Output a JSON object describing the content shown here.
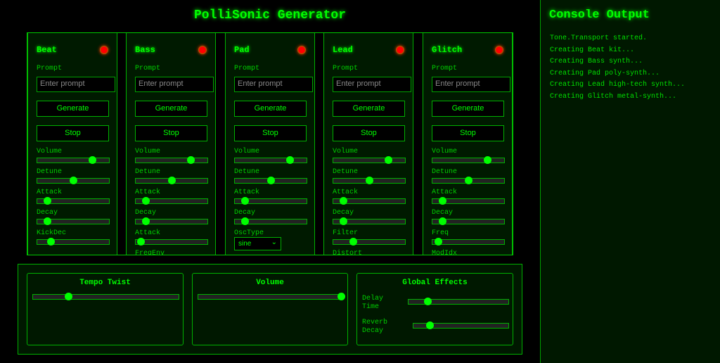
{
  "title": "PolliSonic Generator",
  "colors": {
    "accent": "#00ff00",
    "background": "#000000",
    "panel": "#001a00",
    "led": "#ff0000"
  },
  "channels": [
    {
      "name": "Beat",
      "prompt_label": "Prompt",
      "placeholder": "Enter prompt",
      "generate": "Generate",
      "stop": "Stop",
      "sliders": [
        {
          "label": "Volume",
          "value": 0.76
        },
        {
          "label": "Detune",
          "value": 0.5
        },
        {
          "label": "Attack",
          "value": 0.14
        },
        {
          "label": "Decay",
          "value": 0.14
        },
        {
          "label": "KickDec",
          "value": 0.19
        }
      ]
    },
    {
      "name": "Bass",
      "prompt_label": "Prompt",
      "placeholder": "Enter prompt",
      "generate": "Generate",
      "stop": "Stop",
      "sliders": [
        {
          "label": "Volume",
          "value": 0.76
        },
        {
          "label": "Detune",
          "value": 0.5
        },
        {
          "label": "Attack",
          "value": 0.14
        },
        {
          "label": "Decay",
          "value": 0.14
        },
        {
          "label": "Attack",
          "value": 0.07
        }
      ],
      "extra_label": "FreqEnv"
    },
    {
      "name": "Pad",
      "prompt_label": "Prompt",
      "placeholder": "Enter prompt",
      "generate": "Generate",
      "stop": "Stop",
      "sliders": [
        {
          "label": "Volume",
          "value": 0.76
        },
        {
          "label": "Detune",
          "value": 0.5
        },
        {
          "label": "Attack",
          "value": 0.14
        },
        {
          "label": "Decay",
          "value": 0.14
        }
      ],
      "select_label": "OscType",
      "select_value": "sine"
    },
    {
      "name": "Lead",
      "prompt_label": "Prompt",
      "placeholder": "Enter prompt",
      "generate": "Generate",
      "stop": "Stop",
      "sliders": [
        {
          "label": "Volume",
          "value": 0.76
        },
        {
          "label": "Detune",
          "value": 0.5
        },
        {
          "label": "Attack",
          "value": 0.14
        },
        {
          "label": "Decay",
          "value": 0.14
        },
        {
          "label": "Filter",
          "value": 0.27
        }
      ],
      "extra_label": "Distort"
    },
    {
      "name": "Glitch",
      "prompt_label": "Prompt",
      "placeholder": "Enter prompt",
      "generate": "Generate",
      "stop": "Stop",
      "sliders": [
        {
          "label": "Volume",
          "value": 0.76
        },
        {
          "label": "Detune",
          "value": 0.5
        },
        {
          "label": "Attack",
          "value": 0.14
        },
        {
          "label": "Decay",
          "value": 0.14
        },
        {
          "label": "Freq",
          "value": 0.08
        }
      ],
      "extra_label": "ModIdx"
    }
  ],
  "global": {
    "tempo": {
      "title": "Tempo Twist",
      "value": 0.24
    },
    "volume": {
      "title": "Volume",
      "value": 1.0
    },
    "effects": {
      "title": "Global Effects",
      "delay_label": "Delay Time",
      "delay_value": 0.19,
      "reverb_label": "Reverb Decay",
      "reverb_value": 0.17
    }
  },
  "console": {
    "title": "Console Output",
    "lines": [
      "Tone.Transport started.",
      "Creating Beat kit...",
      "Creating Bass synth...",
      "Creating Pad poly-synth...",
      "Creating Lead high-tech synth...",
      "Creating Glitch metal-synth..."
    ]
  }
}
